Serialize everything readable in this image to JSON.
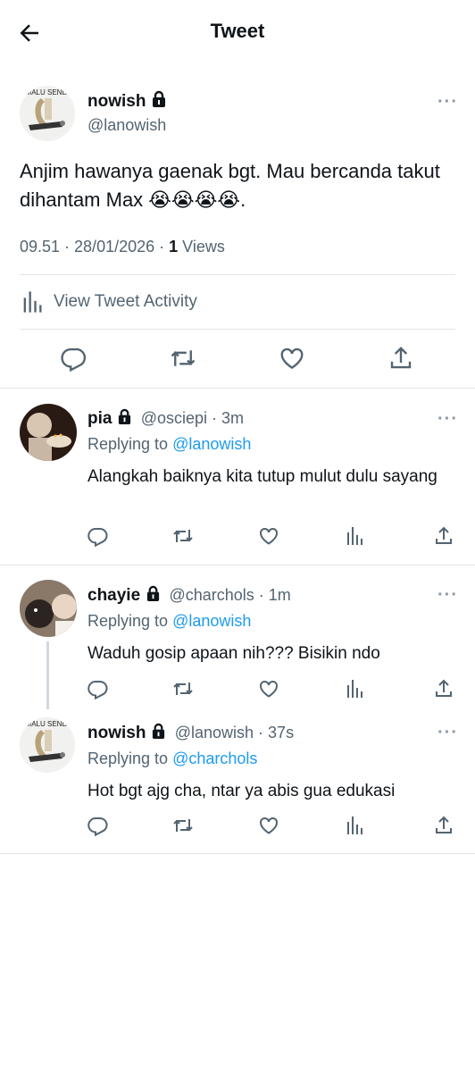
{
  "header": {
    "title": "Tweet"
  },
  "tweet": {
    "name": "nowish",
    "handle": "@lanowish",
    "avatar_text": "MALU SENDI",
    "text": "Anjim hawanya gaenak bgt. Mau bercanda takut dihantam Max 😭😭😭😭.",
    "timestamp": "09.51 · 28/01/2026 · ",
    "views_count": "1",
    "views_label": " Views",
    "activity_label": "View Tweet Activity"
  },
  "replies": [
    {
      "name": "pia",
      "handle": "@osciepi",
      "time": " · 3m",
      "replying_prefix": "Replying to ",
      "replying_to": "@lanowish",
      "text": "Alangkah baiknya kita tutup mulut dulu sayang"
    },
    {
      "name": "chayie",
      "handle": "@charchols",
      "time": " · 1m",
      "replying_prefix": "Replying to ",
      "replying_to": "@lanowish",
      "text": "Waduh gosip apaan nih??? Bisikin ndo"
    },
    {
      "name": "nowish",
      "handle": "@lanowish",
      "time": " · 37s",
      "replying_prefix": "Replying to ",
      "replying_to": "@charchols",
      "text": "Hot bgt ajg cha, ntar ya abis gua edukasi",
      "avatar_text": "MALU SENDI"
    }
  ],
  "icons": {
    "back": "arrow-left-icon",
    "lock": "lock-icon",
    "more": "more-icon",
    "reply": "reply-icon",
    "retweet": "retweet-icon",
    "like": "heart-icon",
    "share": "share-icon",
    "analytics": "analytics-icon"
  },
  "colors": {
    "link": "#1d9bf0",
    "muted": "#536471",
    "divider": "#e1e4e7"
  }
}
